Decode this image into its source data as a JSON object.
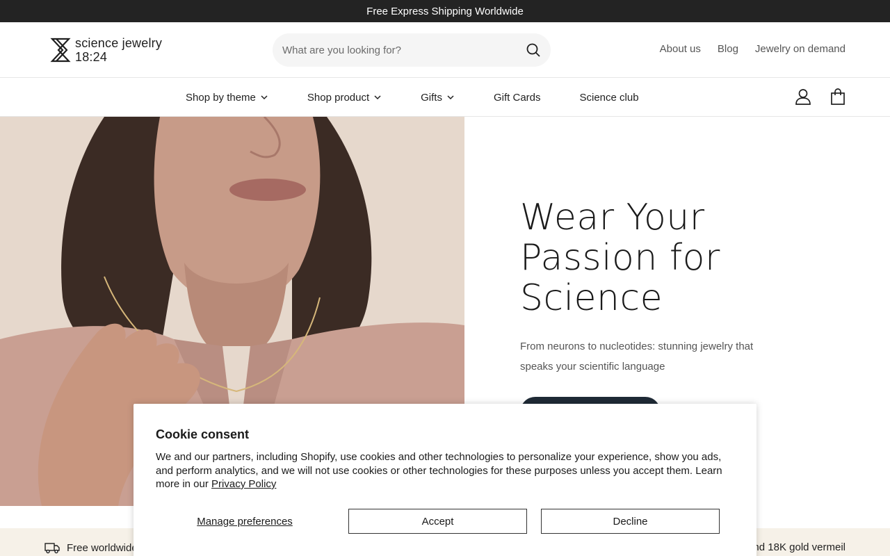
{
  "announcement": "Free Express Shipping Worldwide",
  "header": {
    "logo_line1": "science jewelry",
    "logo_line2": "18:24",
    "search_placeholder": "What are you looking for?",
    "links": [
      "About us",
      "Blog",
      "Jewelry on demand"
    ]
  },
  "nav": {
    "items": [
      {
        "label": "Shop by theme",
        "dropdown": true
      },
      {
        "label": "Shop product",
        "dropdown": true
      },
      {
        "label": "Gifts",
        "dropdown": true
      },
      {
        "label": "Gift Cards",
        "dropdown": false
      },
      {
        "label": "Science club",
        "dropdown": false
      }
    ],
    "icons": [
      "account-icon",
      "cart-icon"
    ]
  },
  "hero": {
    "title_line1": "Wear Your",
    "title_line2": "Passion for",
    "title_highlight": "Science",
    "subtitle": "From neurons to nucleotides: stunning jewelry that speaks your scientific language",
    "highlight_color": "#ecdcb0",
    "cta_color": "#1f2a36"
  },
  "benefits": {
    "left": "Free worldwide",
    "right": "nd 18K gold vermeil"
  },
  "cookie": {
    "title": "Cookie consent",
    "body": "We and our partners, including Shopify, use cookies and other technologies to personalize your experience, show you ads, and perform analytics, and we will not use cookies or other technologies for these purposes unless you accept them. Learn more in our ",
    "policy_link": "Privacy Policy",
    "manage_label": "Manage preferences",
    "accept_label": "Accept",
    "decline_label": "Decline"
  }
}
